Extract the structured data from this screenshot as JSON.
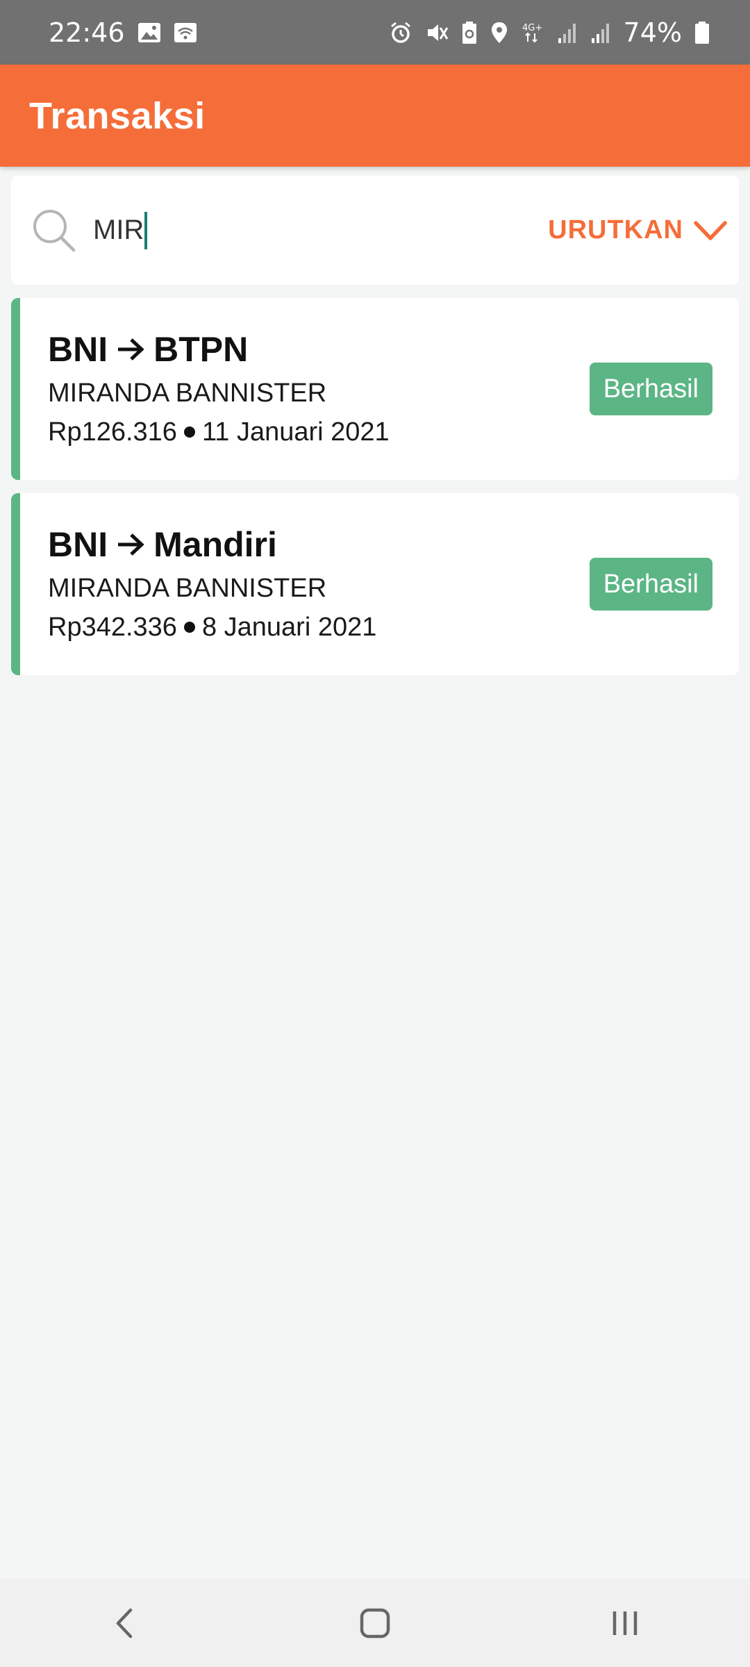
{
  "status_bar": {
    "time": "22:46",
    "battery": "74%",
    "icons": [
      "image-icon",
      "wifi-icon",
      "alarm-icon",
      "mute-icon",
      "battery-saver-icon",
      "location-icon",
      "4g-icon",
      "signal-icon",
      "signal-icon",
      "battery-icon"
    ]
  },
  "header": {
    "title": "Transaksi"
  },
  "search": {
    "value": "MIR",
    "sort_label": "URUTKAN"
  },
  "transactions": [
    {
      "from": "BNI",
      "to": "BTPN",
      "name": "MIRANDA BANNISTER",
      "amount": "Rp126.316",
      "date": "11 Januari 2021",
      "status": "Berhasil"
    },
    {
      "from": "BNI",
      "to": "Mandiri",
      "name": "MIRANDA BANNISTER",
      "amount": "Rp342.336",
      "date": "8 Januari 2021",
      "status": "Berhasil"
    }
  ],
  "colors": {
    "accent": "#f56d39",
    "success": "#5cb585",
    "background": "#f4f6f5"
  }
}
